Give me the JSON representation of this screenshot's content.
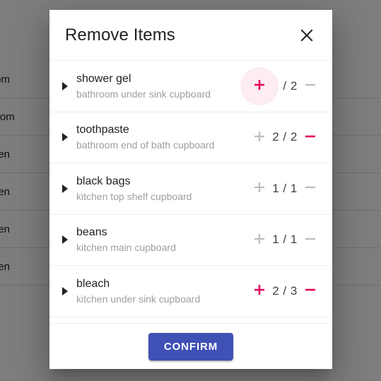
{
  "background": {
    "column_values": [
      "Room",
      "throom",
      "itchen",
      "itchen",
      "itchen",
      "itchen"
    ]
  },
  "dialog": {
    "title": "Remove Items",
    "close_icon": "close-icon",
    "items": [
      {
        "name": "shower gel",
        "location": "bathroom under sink cupboard",
        "count": "1 / 2",
        "plus_label": "+",
        "minus_label": "—",
        "plus_enabled": true,
        "minus_enabled": false,
        "plus_highlighted": true
      },
      {
        "name": "toothpaste",
        "location": "bathroom end of bath cupboard",
        "count": "2 / 2",
        "plus_label": "+",
        "minus_label": "—",
        "plus_enabled": false,
        "minus_enabled": true,
        "plus_highlighted": false
      },
      {
        "name": "black bags",
        "location": "kitchen top shelf cupboard",
        "count": "1 / 1",
        "plus_label": "+",
        "minus_label": "—",
        "plus_enabled": false,
        "minus_enabled": false,
        "plus_highlighted": false
      },
      {
        "name": "beans",
        "location": "kitchen main cupboard",
        "count": "1 / 1",
        "plus_label": "+",
        "minus_label": "—",
        "plus_enabled": false,
        "minus_enabled": false,
        "plus_highlighted": false
      },
      {
        "name": "bleach",
        "location": "kitchen under sink cupboard",
        "count": "2 / 3",
        "plus_label": "+",
        "minus_label": "—",
        "plus_enabled": true,
        "minus_enabled": true,
        "plus_highlighted": false
      }
    ],
    "confirm_label": "CONFIRM"
  },
  "colors": {
    "accent_pink": "#E8005A",
    "disabled_gray": "#BDBDBD",
    "confirm_blue": "#3F51B5",
    "ripple_pink": "#FDECF2",
    "scrim": "#000000"
  }
}
